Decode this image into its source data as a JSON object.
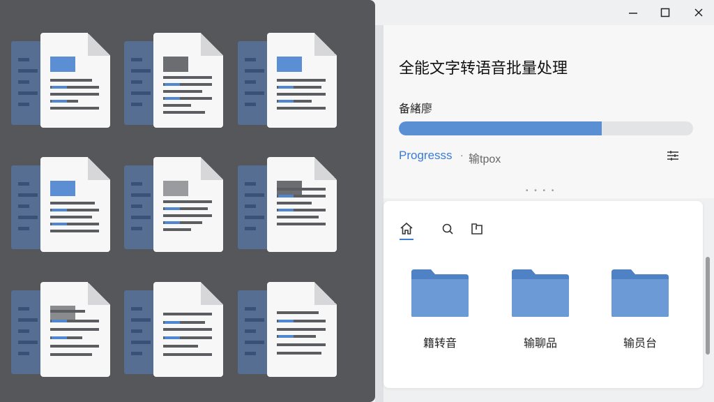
{
  "window": {
    "minimize_icon": "minimize-icon",
    "maximize_icon": "maximize-icon",
    "close_icon": "close-icon"
  },
  "app": {
    "title": "全能文字转语音批量处理"
  },
  "progress": {
    "label": "备緖廖",
    "fraction": 0.69,
    "link_label": "Progresss",
    "separator": "·",
    "output_label": "输tpox",
    "settings_icon": "settings-sliders-icon",
    "drag_handle": "• • • •"
  },
  "tabs": [
    {
      "icon": "home-icon",
      "active": true
    },
    {
      "icon": "search-icon",
      "active": false
    },
    {
      "icon": "folder-icon",
      "active": false
    }
  ],
  "folders": [
    {
      "label": "籍转音"
    },
    {
      "label": "输聊品"
    },
    {
      "label": "输员台"
    }
  ],
  "colors": {
    "accent": "#3a7bd5",
    "progress_fill": "#5a8fd3",
    "left_panel": "#55575b",
    "folder": "#5b8fd0"
  }
}
